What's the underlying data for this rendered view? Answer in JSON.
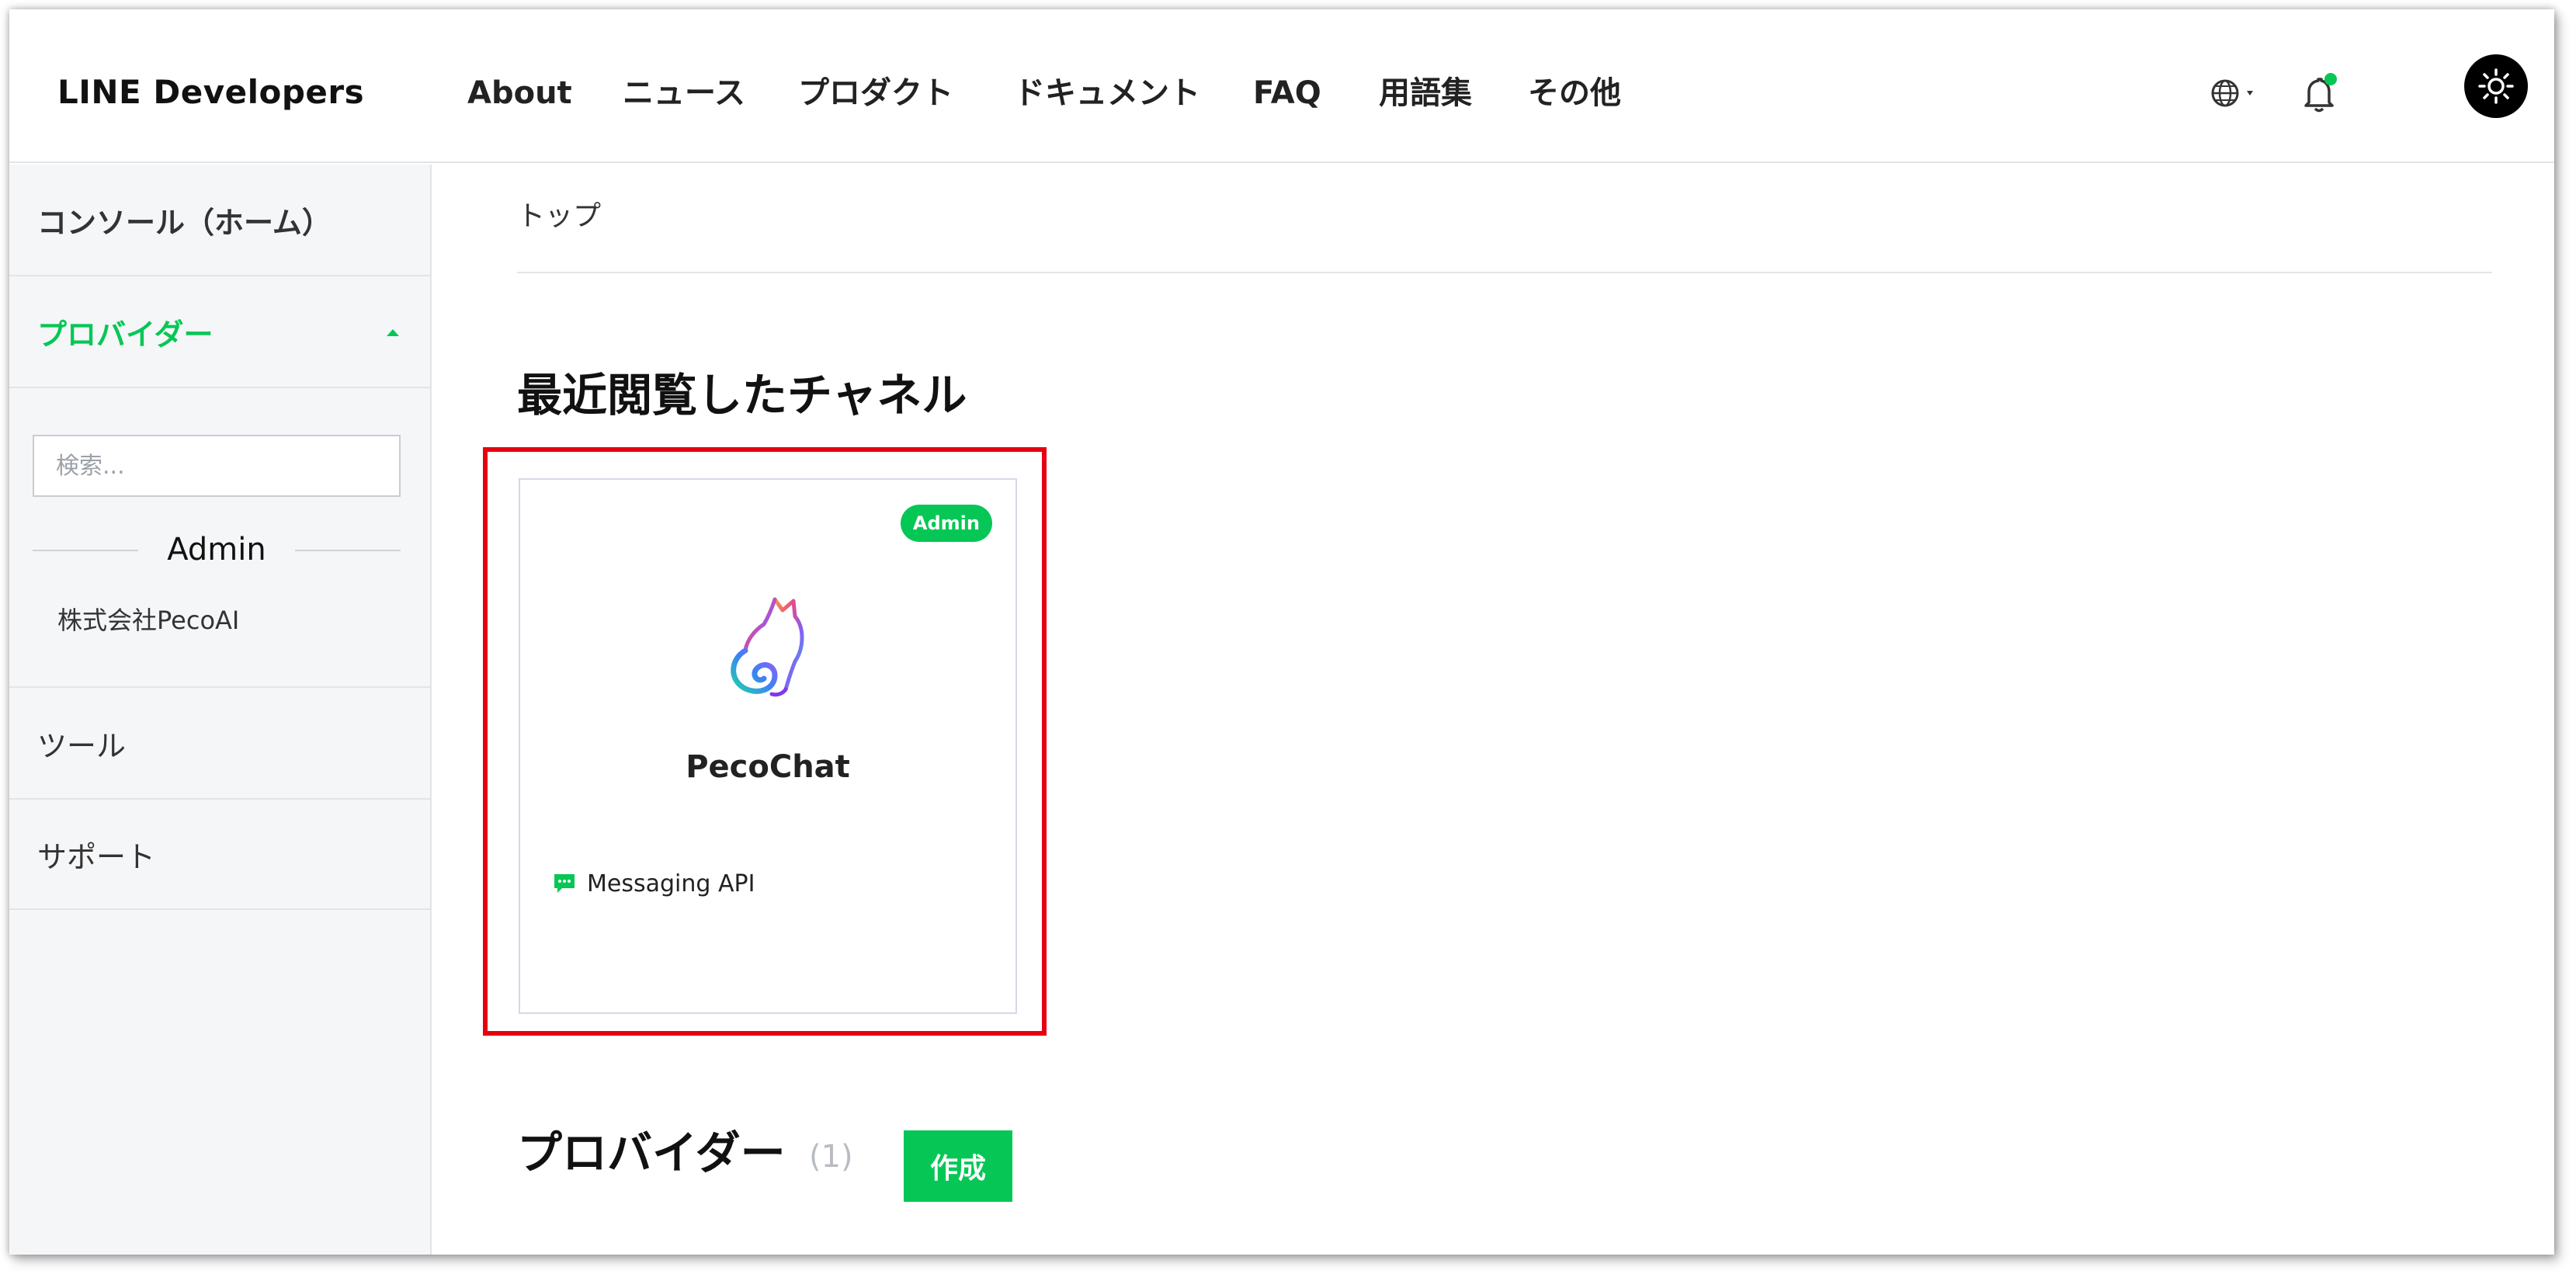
{
  "header": {
    "logo": "LINE Developers",
    "nav": [
      "About",
      "ニュース",
      "プロダクト",
      "ドキュメント",
      "FAQ",
      "用語集",
      "その他"
    ],
    "icons": [
      "globe-icon",
      "bell-icon",
      "sun-icon"
    ]
  },
  "sidebar": {
    "console_home": "コンソール（ホーム）",
    "providers_label": "プロバイダー",
    "search_placeholder": "検索...",
    "admin_heading": "Admin",
    "provider_item": "株式会社PecoAI",
    "tools": "ツール",
    "support": "サポート"
  },
  "main": {
    "breadcrumb": "トップ",
    "recent_title": "最近閲覧したチャネル",
    "channel": {
      "badge": "Admin",
      "name": "PecoChat",
      "type": "Messaging API"
    },
    "providers_title": "プロバイダー",
    "providers_count": "(1)",
    "create_label": "作成"
  },
  "colors": {
    "brand_green": "#06c755",
    "highlight_red": "#e60012",
    "sidebar_bg": "#f5f6f8"
  }
}
